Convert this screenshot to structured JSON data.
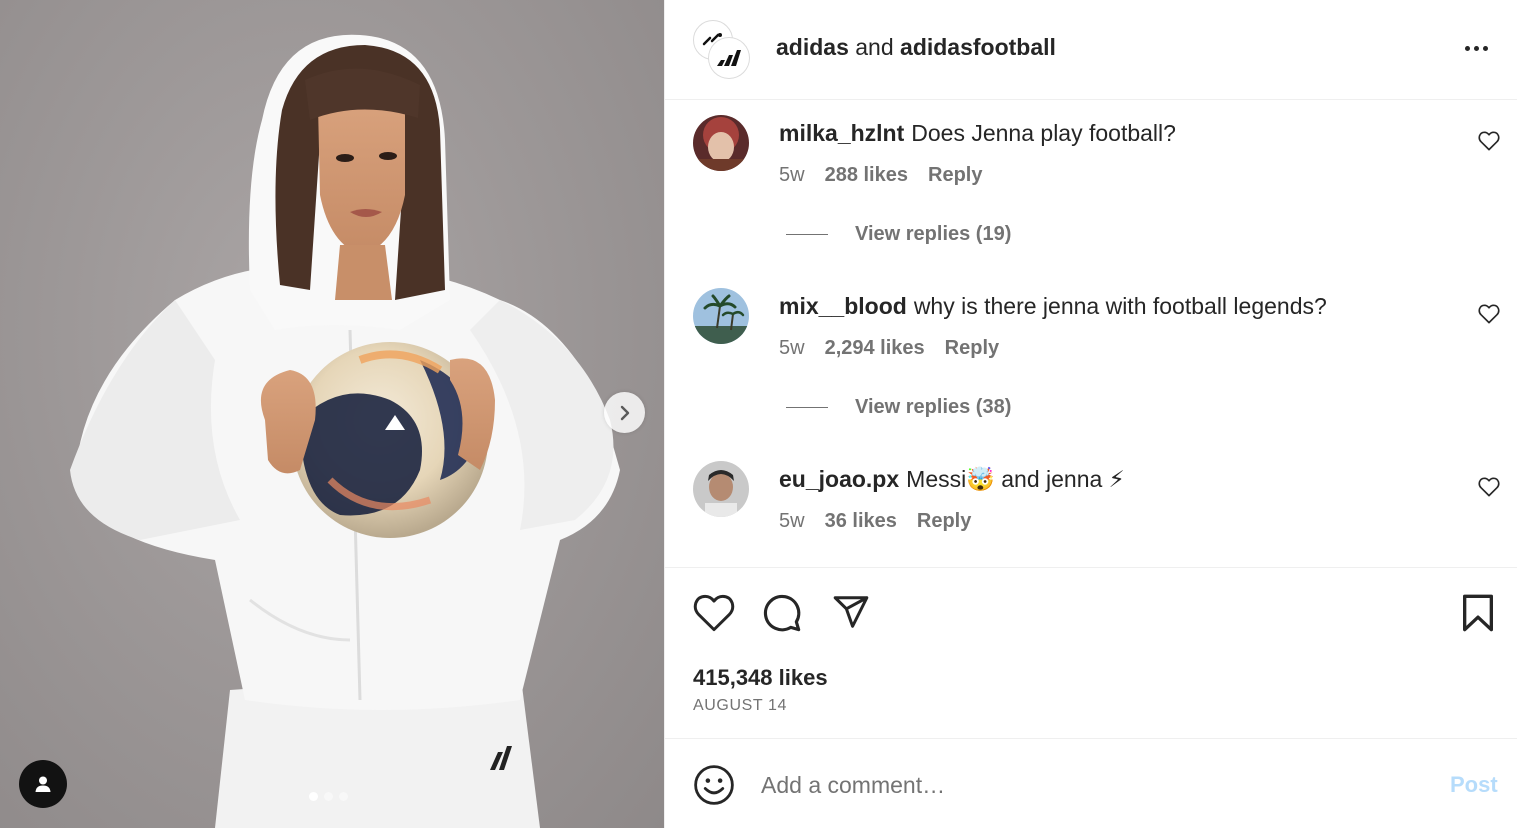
{
  "post": {
    "author_primary": "adidas",
    "joiner": "and",
    "author_secondary": "adidasfootball",
    "likes": "415,348 likes",
    "date": "AUGUST 14"
  },
  "media": {
    "slide_count": 3,
    "active_slide": 1
  },
  "comments": [
    {
      "username": "milka_hzlnt",
      "text": "Does Jenna play football?",
      "age": "5w",
      "likes": "288 likes",
      "reply": "Reply",
      "view_replies": "View replies (19)"
    },
    {
      "username": "mix__blood",
      "text": "why is there jenna with football legends?",
      "age": "5w",
      "likes": "2,294 likes",
      "reply": "Reply",
      "view_replies": "View replies (38)"
    },
    {
      "username": "eu_joao.px",
      "text": "Messi🤯 and jenna ⚡",
      "age": "5w",
      "likes": "36 likes",
      "reply": "Reply"
    }
  ],
  "comment_box": {
    "placeholder": "Add a comment…",
    "post_label": "Post"
  },
  "colors": {
    "text": "#262626",
    "muted": "#737373",
    "post_button": "#b6dcfb",
    "divider": "#efefef"
  },
  "icons": {
    "like": "heart-icon",
    "comment": "comment-bubble-icon",
    "share": "paper-plane-icon",
    "save": "bookmark-icon",
    "emoji": "smiley-icon",
    "more": "more-dots-icon",
    "next": "chevron-right-icon",
    "tag": "user-tag-icon"
  }
}
